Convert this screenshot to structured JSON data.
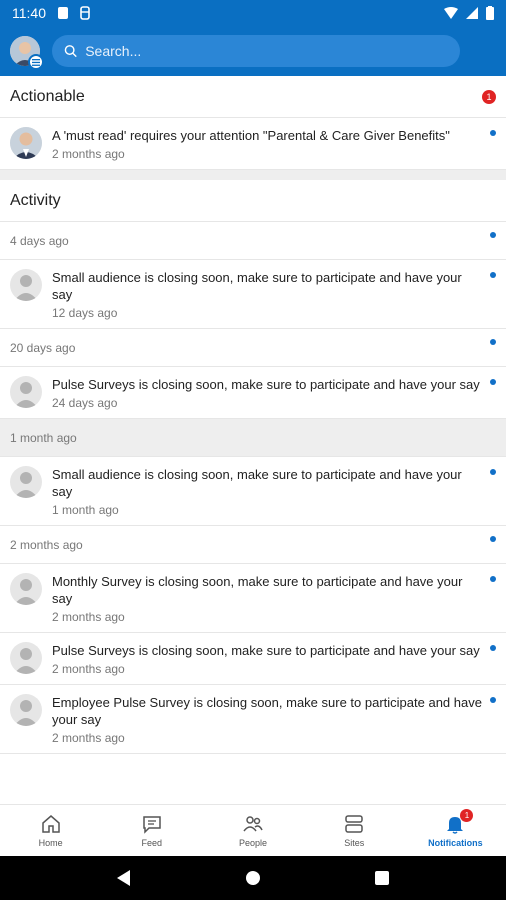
{
  "status_bar": {
    "time": "11:40"
  },
  "header": {
    "search_placeholder": "Search..."
  },
  "actionable": {
    "title": "Actionable",
    "badge_count": "1",
    "items": [
      {
        "title": "A 'must read' requires your attention \"Parental & Care Giver Benefits\"",
        "time": "2 months ago",
        "unread": true
      }
    ]
  },
  "activity": {
    "title": "Activity",
    "groups": [
      {
        "label": "4 days ago",
        "unread": true,
        "highlight": false,
        "items": [
          {
            "title": "Small audience is closing soon, make sure to participate and have your say",
            "time": "12 days ago",
            "unread": true
          }
        ]
      },
      {
        "label": "20 days ago",
        "unread": true,
        "highlight": false,
        "items": [
          {
            "title": "Pulse Surveys is closing soon, make sure to participate and have your say",
            "time": "24 days ago",
            "unread": true
          }
        ]
      },
      {
        "label": "1 month ago",
        "unread": false,
        "highlight": true,
        "items": [
          {
            "title": "Small audience is closing soon, make sure to participate and have your say",
            "time": "1 month ago",
            "unread": true
          }
        ]
      },
      {
        "label": "2 months ago",
        "unread": true,
        "highlight": false,
        "items": [
          {
            "title": "Monthly Survey is closing soon, make sure to participate and have your say",
            "time": "2 months ago",
            "unread": true
          },
          {
            "title": "Pulse Surveys is closing soon, make sure to participate and have your say",
            "time": "2 months ago",
            "unread": true
          },
          {
            "title": "Employee Pulse Survey is closing soon, make sure to participate and have your say",
            "time": "2 months ago",
            "unread": true
          }
        ]
      }
    ]
  },
  "bottom_nav": {
    "items": [
      {
        "label": "Home",
        "icon": "home-icon",
        "active": false
      },
      {
        "label": "Feed",
        "icon": "feed-icon",
        "active": false
      },
      {
        "label": "People",
        "icon": "people-icon",
        "active": false
      },
      {
        "label": "Sites",
        "icon": "sites-icon",
        "active": false
      },
      {
        "label": "Notifications",
        "icon": "bell-icon",
        "active": true,
        "badge": "1"
      }
    ]
  },
  "colors": {
    "brand": "#0a6fc2",
    "accent": "#1170c8",
    "badge": "#e02424"
  }
}
